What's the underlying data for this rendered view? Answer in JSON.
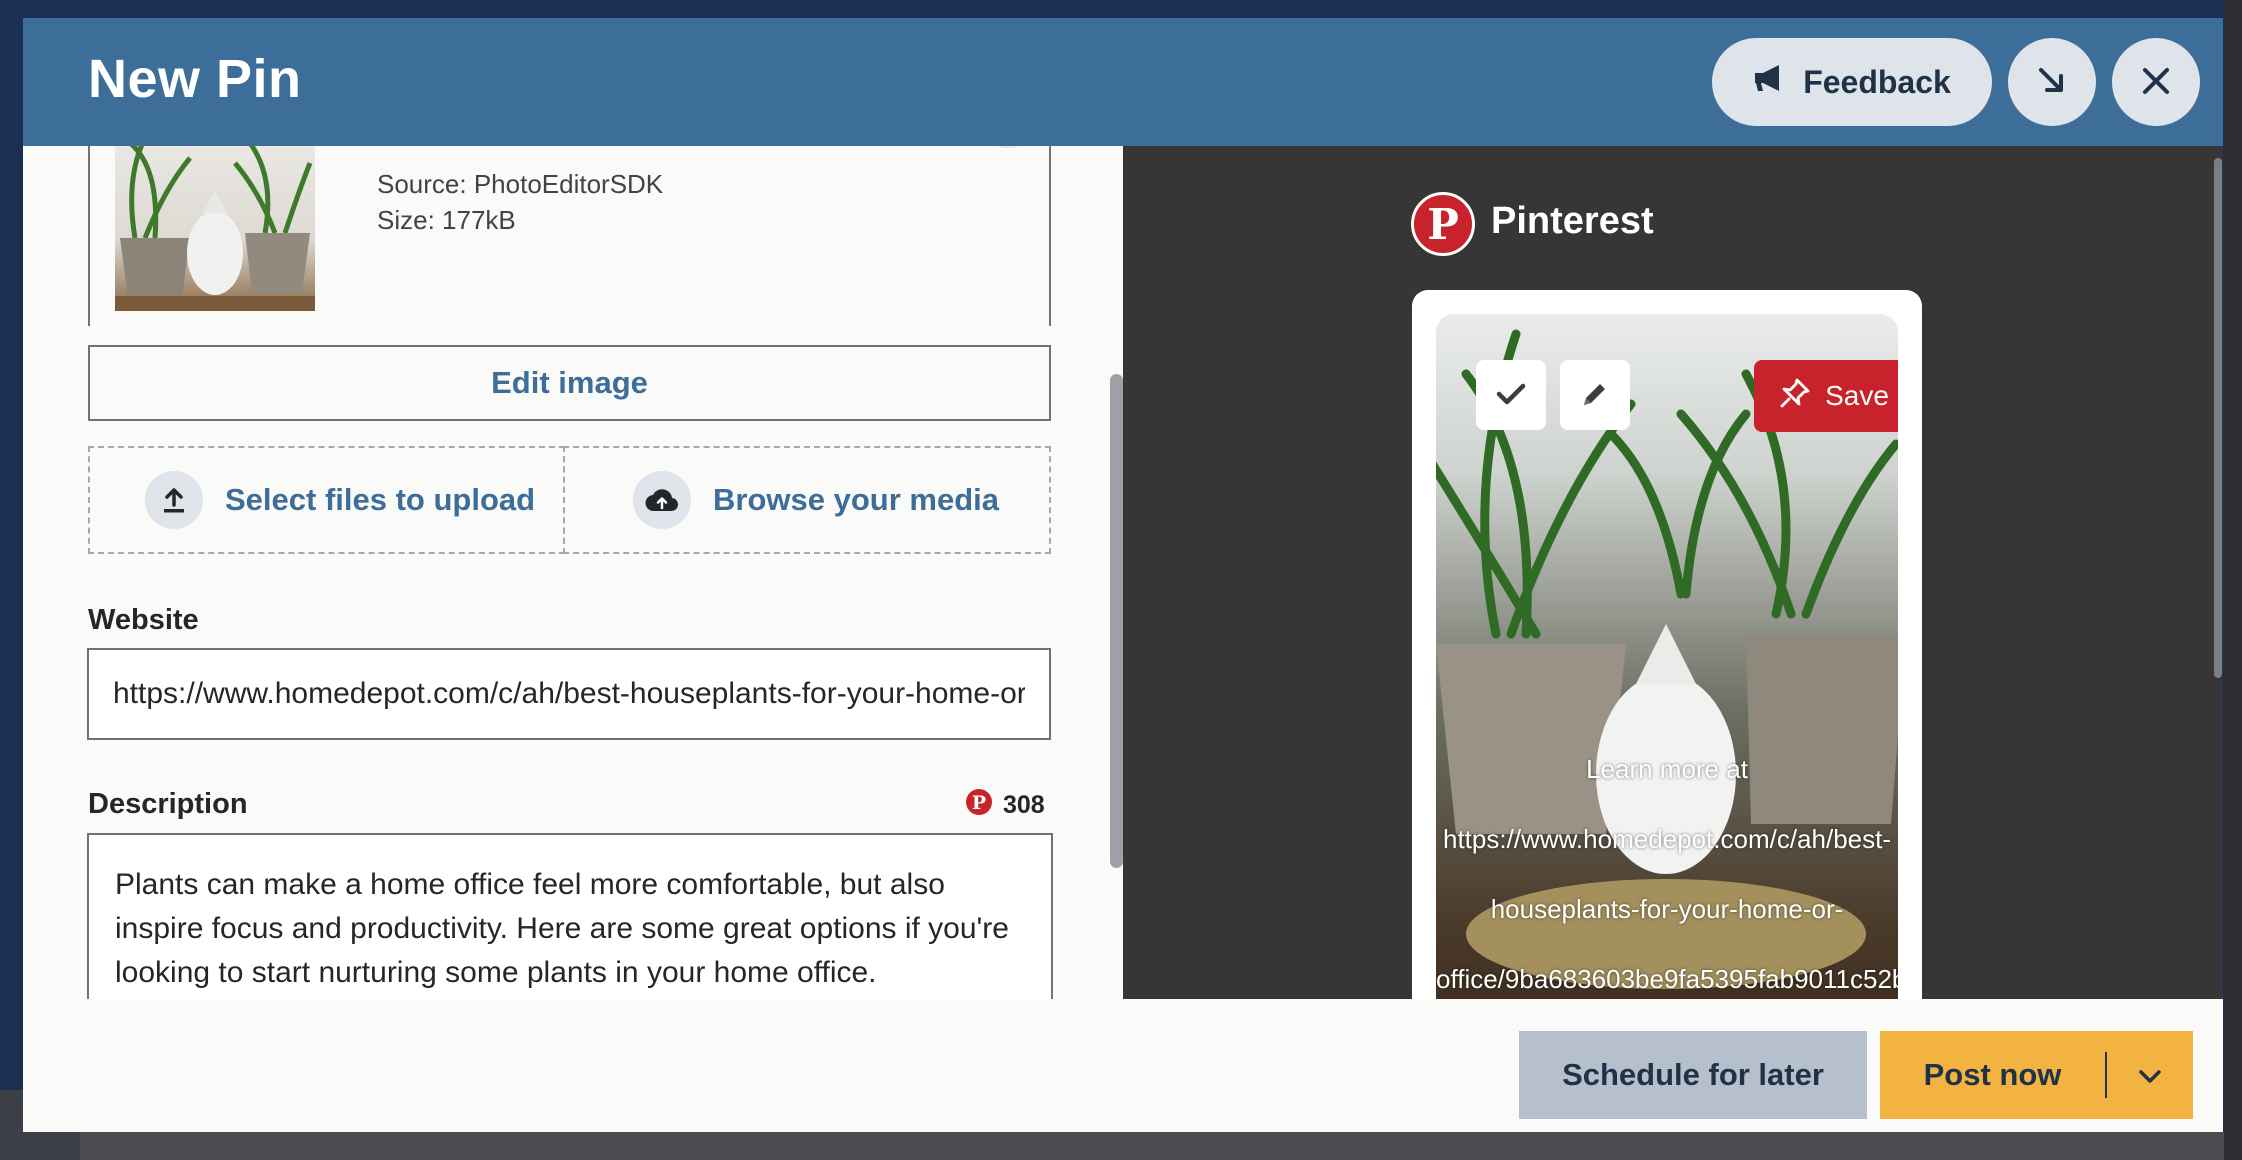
{
  "header": {
    "title": "New Pin",
    "feedback_label": "Feedback"
  },
  "media": {
    "source": "Source: PhotoEditorSDK",
    "size": "Size: 177kB",
    "edit_label": "Edit image",
    "upload_label": "Select files to upload",
    "browse_label": "Browse your media"
  },
  "website": {
    "label": "Website",
    "value": "https://www.homedepot.com/c/ah/best-houseplants-for-your-home-or-office/9ba683603be9fa5395fab9011c52b"
  },
  "description": {
    "label": "Description",
    "count": "308",
    "text": "Plants can make a home office feel more comfortable, but also inspire focus and productivity. Here are some great options if you're looking to start nurturing some plants in your home office."
  },
  "preview": {
    "network": "Pinterest",
    "network_logo": "P",
    "save_label": "Save",
    "overlay_lines": [
      "Learn more at",
      "https://www.homedepot.com/c/ah/best-",
      "houseplants-for-your-home-or-",
      "office/9ba683603be9fa5395fab9011c52b"
    ]
  },
  "footer": {
    "schedule_label": "Schedule for later",
    "post_label": "Post now"
  },
  "colors": {
    "header": "#3d6d99",
    "accent_link": "#3d6d99",
    "pinterest_red": "#c8232c",
    "post_button": "#f2b340",
    "schedule_button": "#b6bfcc",
    "preview_bg": "#383536"
  }
}
